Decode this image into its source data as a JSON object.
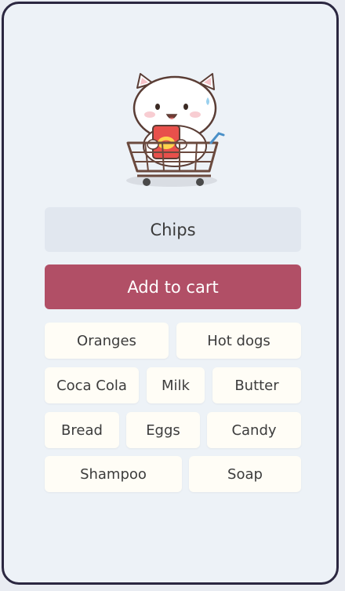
{
  "mascot": {
    "icon": "cat-in-shopping-cart-icon"
  },
  "form": {
    "item_value": "Chips",
    "add_label": "Add to cart"
  },
  "suggestions": [
    "Oranges",
    "Hot dogs",
    "Coca Cola",
    "Milk",
    "Butter",
    "Bread",
    "Eggs",
    "Candy",
    "Shampoo",
    "Soap"
  ],
  "colors": {
    "accent": "#b14f66",
    "input_bg": "#e1e7ef",
    "chip_bg": "#fffdf6",
    "frame": "#2b2740"
  }
}
